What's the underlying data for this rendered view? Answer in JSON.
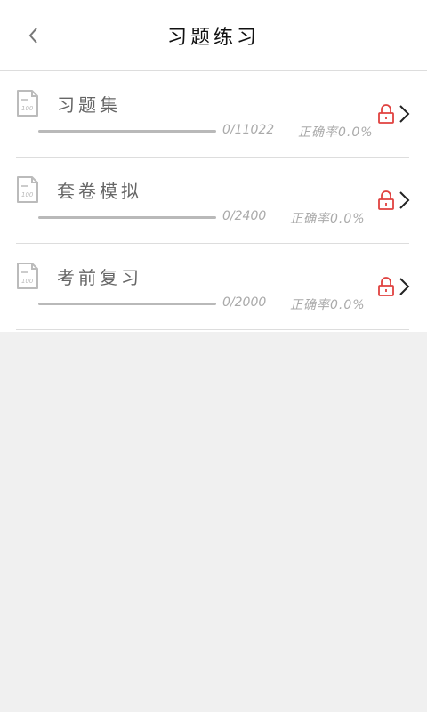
{
  "header": {
    "title": "习题练习",
    "back_icon": "chevron-left-icon"
  },
  "items": [
    {
      "label": "习题集",
      "count": "0/11022",
      "accuracy": "正确率0.0%",
      "progress": 0,
      "locked": true
    },
    {
      "label": "套卷模拟",
      "count": "0/2400",
      "accuracy": "正确率0.0%",
      "progress": 0,
      "locked": true
    },
    {
      "label": "考前复习",
      "count": "0/2000",
      "accuracy": "正确率0.0%",
      "progress": 0,
      "locked": true
    }
  ],
  "colors": {
    "lock": "#e0413f",
    "text_primary": "#111111",
    "text_secondary": "#666666",
    "text_muted": "#aaaaaa",
    "track": "#b9b9b9",
    "background": "#f0f0f0"
  }
}
